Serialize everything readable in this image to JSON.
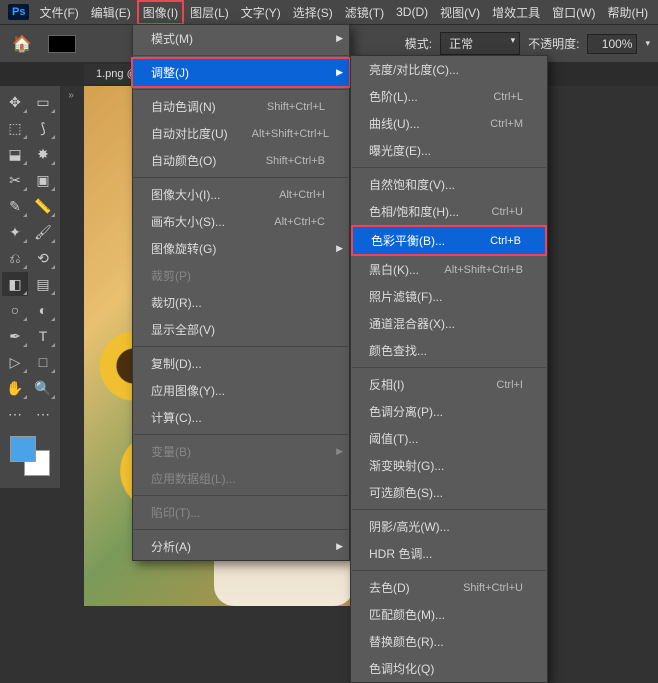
{
  "menubar": {
    "items": [
      "文件(F)",
      "编辑(E)",
      "图像(I)",
      "图层(L)",
      "文字(Y)",
      "选择(S)",
      "滤镜(T)",
      "3D(D)",
      "视图(V)",
      "增效工具",
      "窗口(W)",
      "帮助(H)"
    ],
    "active_index": 2
  },
  "toolbar": {
    "mode_label": "模式:",
    "mode_value": "正常",
    "opacity_label": "不透明度:",
    "opacity_value": "100%"
  },
  "tab": {
    "filename": "1.png @"
  },
  "menu1": {
    "groups": [
      [
        {
          "label": "模式(M)",
          "arrow": true
        }
      ],
      [
        {
          "label": "调整(J)",
          "arrow": true,
          "selected": true,
          "redbox": true
        }
      ],
      [
        {
          "label": "自动色调(N)",
          "shortcut": "Shift+Ctrl+L"
        },
        {
          "label": "自动对比度(U)",
          "shortcut": "Alt+Shift+Ctrl+L"
        },
        {
          "label": "自动颜色(O)",
          "shortcut": "Shift+Ctrl+B"
        }
      ],
      [
        {
          "label": "图像大小(I)...",
          "shortcut": "Alt+Ctrl+I"
        },
        {
          "label": "画布大小(S)...",
          "shortcut": "Alt+Ctrl+C"
        },
        {
          "label": "图像旋转(G)",
          "arrow": true
        },
        {
          "label": "裁剪(P)",
          "disabled": true
        },
        {
          "label": "裁切(R)..."
        },
        {
          "label": "显示全部(V)"
        }
      ],
      [
        {
          "label": "复制(D)..."
        },
        {
          "label": "应用图像(Y)..."
        },
        {
          "label": "计算(C)..."
        }
      ],
      [
        {
          "label": "变量(B)",
          "arrow": true,
          "disabled": true
        },
        {
          "label": "应用数据组(L)...",
          "disabled": true
        }
      ],
      [
        {
          "label": "陷印(T)...",
          "disabled": true
        }
      ],
      [
        {
          "label": "分析(A)",
          "arrow": true
        }
      ]
    ]
  },
  "menu2": {
    "groups": [
      [
        {
          "label": "亮度/对比度(C)..."
        },
        {
          "label": "色阶(L)...",
          "shortcut": "Ctrl+L"
        },
        {
          "label": "曲线(U)...",
          "shortcut": "Ctrl+M"
        },
        {
          "label": "曝光度(E)..."
        }
      ],
      [
        {
          "label": "自然饱和度(V)..."
        },
        {
          "label": "色相/饱和度(H)...",
          "shortcut": "Ctrl+U"
        },
        {
          "label": "色彩平衡(B)...",
          "shortcut": "Ctrl+B",
          "selected": true,
          "redbox": true
        },
        {
          "label": "黑白(K)...",
          "shortcut": "Alt+Shift+Ctrl+B"
        },
        {
          "label": "照片滤镜(F)..."
        },
        {
          "label": "通道混合器(X)..."
        },
        {
          "label": "颜色查找..."
        }
      ],
      [
        {
          "label": "反相(I)",
          "shortcut": "Ctrl+I"
        },
        {
          "label": "色调分离(P)..."
        },
        {
          "label": "阈值(T)..."
        },
        {
          "label": "渐变映射(G)..."
        },
        {
          "label": "可选颜色(S)..."
        }
      ],
      [
        {
          "label": "阴影/高光(W)..."
        },
        {
          "label": "HDR 色调..."
        }
      ],
      [
        {
          "label": "去色(D)",
          "shortcut": "Shift+Ctrl+U"
        },
        {
          "label": "匹配颜色(M)..."
        },
        {
          "label": "替换颜色(R)..."
        },
        {
          "label": "色调均化(Q)"
        }
      ]
    ]
  },
  "tools": [
    "move",
    "artboard",
    "marquee",
    "lasso",
    "object-select",
    "quick-select",
    "crop",
    "frame",
    "eyedropper",
    "ruler",
    "spot-heal",
    "brush",
    "clone",
    "history",
    "eraser",
    "gradient",
    "blur",
    "dodge",
    "pen",
    "text",
    "path-select",
    "rectangle",
    "hand",
    "zoom",
    "edit-toolbar",
    "more"
  ]
}
